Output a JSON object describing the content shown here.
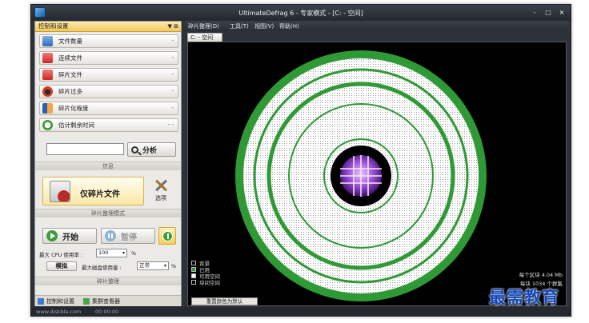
{
  "window": {
    "title": "UltimateDefrag 6 - 专家模式 - [C: - 空间]",
    "buttons": [
      "-",
      "□",
      "×"
    ]
  },
  "left_panel": {
    "header": "控制和设置",
    "header_buttons": "▼ ⊠",
    "stats": [
      {
        "label": "文件数量",
        "value": "-",
        "icon": "files-icon"
      },
      {
        "label": "连续文件",
        "value": "-",
        "icon": "contiguous-files-icon"
      },
      {
        "label": "碎片文件",
        "value": "-",
        "icon": "fragmented-files-icon"
      },
      {
        "label": "碎片过多",
        "value": "-",
        "icon": "too-fragmented-icon"
      },
      {
        "label": "碎片化程度",
        "value": "-",
        "icon": "fragmentation-level-icon"
      },
      {
        "label": "估计剩余时间",
        "value": "- -",
        "icon": "clock-icon"
      }
    ],
    "search_placeholder": "",
    "analyze_label": "分析",
    "info_caption": "信息",
    "mode_button_label": "仅碎片文件",
    "options_label": "选项",
    "mode_caption": "碎片整理模式",
    "start_label": "开始",
    "pause_label": "暂停",
    "cpu_label": "最大 CPU 使用率 :",
    "cpu_value": "100",
    "cpu_unit": "%",
    "simulate_label": "模拟",
    "disk_label": "最大磁盘使用量 :",
    "disk_value": "正常",
    "disk_unit": "%",
    "control_caption": "碎片整理",
    "bottom_tabs": [
      "控制和设置",
      "集群查看器"
    ]
  },
  "statusbar": {
    "url": "www.diskbla.com",
    "time": "00:00:00"
  },
  "menubar": {
    "items": [
      "碎片整理(D)",
      "工具(T)",
      "视图(V)",
      "帮助(H)"
    ]
  },
  "view": {
    "tab_label": "C: - 空间",
    "legend": [
      {
        "label": "背景",
        "color": "#000000"
      },
      {
        "label": "已用",
        "color": "#2f9a35"
      },
      {
        "label": "可用空间",
        "color": "#ffffff"
      },
      {
        "label": "块间空间",
        "color": "#000000"
      }
    ],
    "reset_button": "重置颜色为默认",
    "info_lines": [
      "每个区块 4.04 Mb",
      "每块 1034 个群集"
    ]
  },
  "colors": {
    "used": "#2f9a35",
    "free": "#ffffff",
    "background": "#000000",
    "accent": "#f2cb61"
  },
  "watermark": "最需教育"
}
